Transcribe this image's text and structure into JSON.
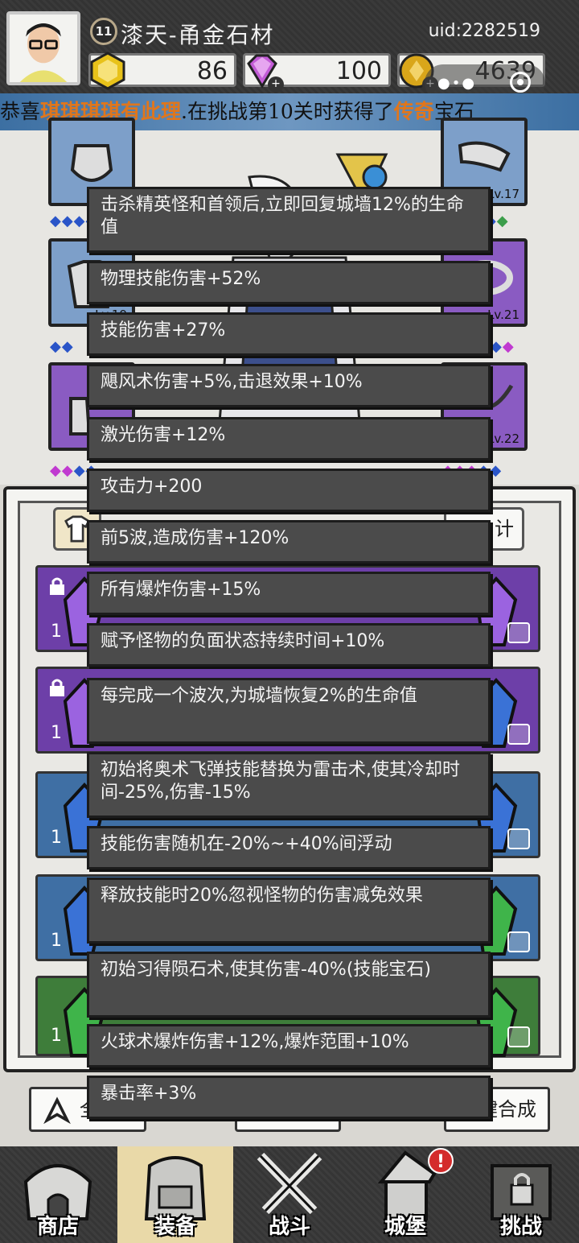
{
  "header": {
    "level": "11",
    "player_name": "漆天-甬金石材",
    "uid": "uid:2282519",
    "gold_hex": "86",
    "diamonds": "100",
    "coins": "4639"
  },
  "announcement": {
    "prefix": "恭喜",
    "player": "琪琪琪琪有此理",
    "middle": ".在挑战第10关时获得了",
    "rarity": "传奇",
    "suffix": "宝石"
  },
  "equipment": {
    "slot_levels": [
      "Lv.17",
      "Lv.19",
      "Lv.21",
      "Lv.22"
    ]
  },
  "bag": {
    "tab_right_label": "计",
    "rows": [
      {
        "count": "1"
      },
      {
        "count": "1"
      },
      {
        "count": "1"
      },
      {
        "count": "1"
      },
      {
        "count": "1"
      }
    ]
  },
  "affixes": [
    "击杀精英怪和首领后,立即回复城墙12%的生命值",
    "物理技能伤害+52%",
    "技能伤害+27%",
    "飓风术伤害+5%,击退效果+10%",
    "激光伤害+12%",
    "攻击力+200",
    "前5波,造成伤害+120%",
    "所有爆炸伤害+15%",
    "赋予怪物的负面状态持续时间+10%",
    "每完成一个波次,为城墙恢复2%的生命值",
    "初始将奥术飞弹技能替换为雷击术,使其冷却时间-25%,伤害-15%",
    "技能伤害随机在-20%~+40%间浮动",
    "释放技能时20%忽视怪物的伤害减免效果",
    "初始习得陨石术,使其伤害-40%(技能宝石)",
    "火球术爆炸伤害+12%,爆炸范围+10%",
    "暴击率+3%"
  ],
  "bottom_buttons": {
    "left": "全",
    "right": "键合成"
  },
  "nav": {
    "shop": "商店",
    "equipment": "装备",
    "battle": "战斗",
    "castle": "城堡",
    "challenge": "挑战",
    "alert": "!"
  },
  "colors": {
    "accent_orange": "#e0761c",
    "announce_blue": "#5b86b6",
    "tooltip_bg": "#4b4b4b",
    "purple_rarity": "#6d3fa8",
    "blue_rarity": "#3f6fa4",
    "green_rarity": "#3e7d3a"
  }
}
